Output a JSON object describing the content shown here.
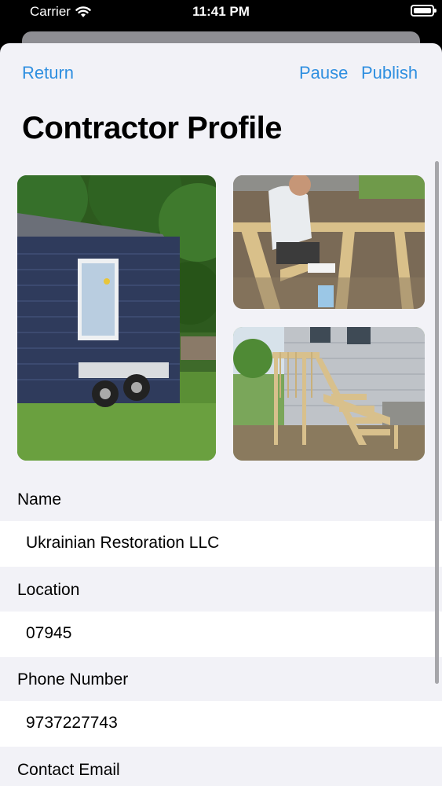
{
  "status_bar": {
    "carrier": "Carrier",
    "time": "11:41 PM"
  },
  "nav": {
    "return_label": "Return",
    "pause_label": "Pause",
    "publish_label": "Publish"
  },
  "page_title": "Contractor Profile",
  "fields": [
    {
      "label": "Name",
      "value": "Ukrainian Restoration LLC"
    },
    {
      "label": "Location",
      "value": "07945"
    },
    {
      "label": "Phone Number",
      "value": "9737227743"
    },
    {
      "label": "Contact Email",
      "value": ""
    }
  ],
  "colors": {
    "accent": "#2f8fe0",
    "sheet_background": "#f2f2f7"
  }
}
